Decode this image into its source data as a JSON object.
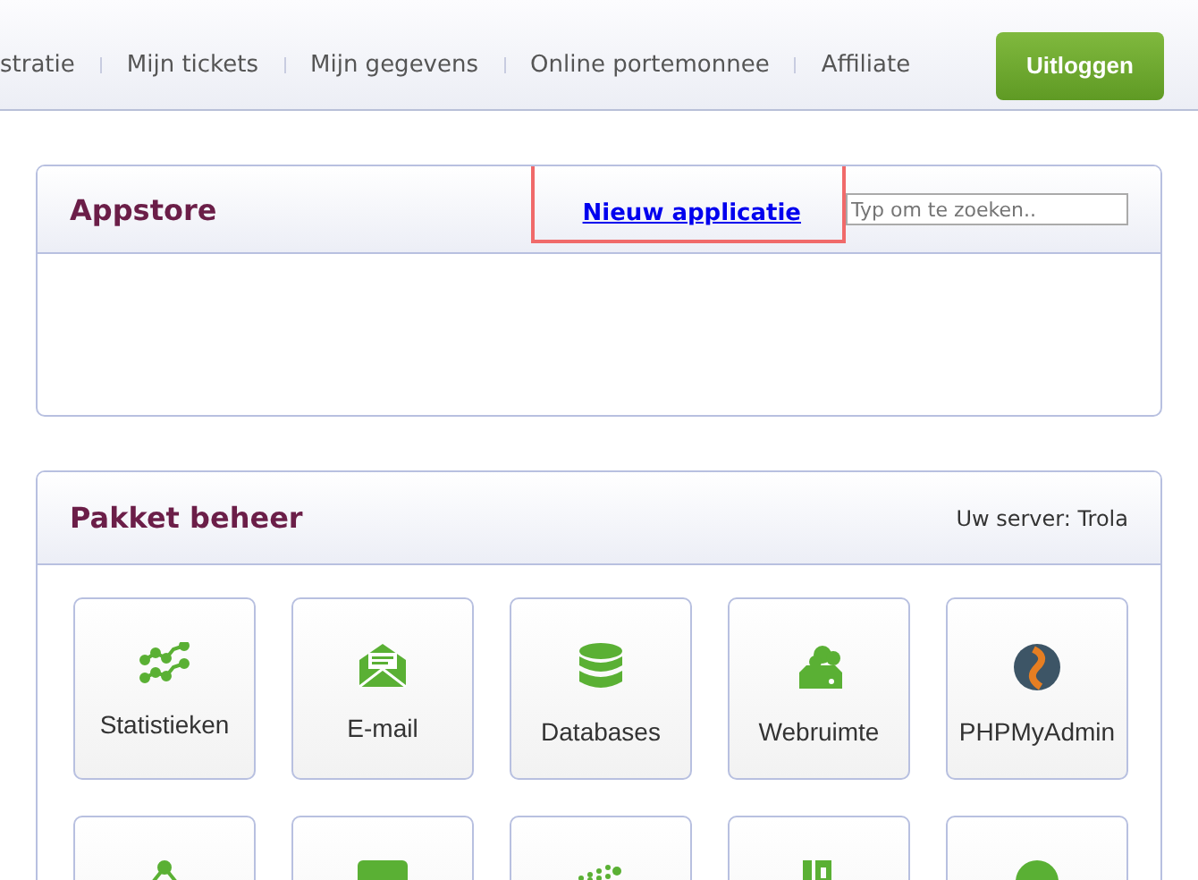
{
  "nav": {
    "items": [
      "stratie",
      "Mijn tickets",
      "Mijn gegevens",
      "Online portemonnee",
      "Affiliate"
    ],
    "logout": "Uitloggen"
  },
  "appstore": {
    "title": "Appstore",
    "link": "Nieuw applicatie",
    "search": {
      "placeholder": "Typ om te zoeken.."
    },
    "highlighted": true
  },
  "package": {
    "title": "Pakket beheer",
    "server": "Uw server: Trola",
    "tiles": [
      {
        "kind": "stats",
        "label": "Statistieken"
      },
      {
        "kind": "mail",
        "label": "E-mail"
      },
      {
        "kind": "database",
        "label": "Databases"
      },
      {
        "kind": "cloud",
        "label": "Webruimte"
      },
      {
        "kind": "phpmyadmin",
        "label": "PHPMyAdmin"
      },
      {
        "kind": "network"
      },
      {
        "kind": "php"
      },
      {
        "kind": "dots"
      },
      {
        "kind": "door"
      },
      {
        "kind": "circle"
      }
    ]
  }
}
